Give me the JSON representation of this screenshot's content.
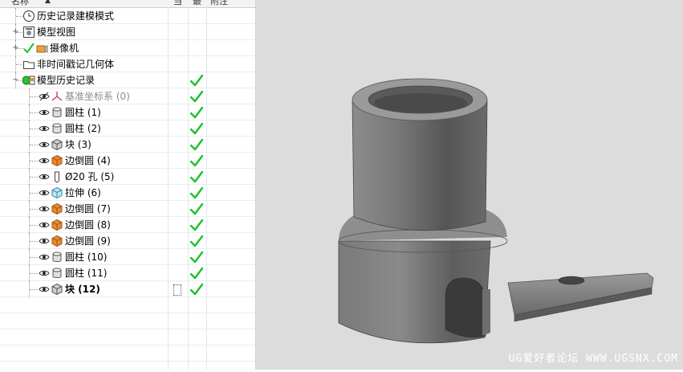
{
  "header": {
    "name_col": "名称",
    "col2": "当",
    "col3": "最",
    "col4": "附注"
  },
  "tree": [
    {
      "label": "历史记录建模模式",
      "icon": "clock-icon",
      "checked": false,
      "expander": ""
    },
    {
      "label": "模型视图",
      "icon": "model-view-icon",
      "checked": false,
      "expander": "+"
    },
    {
      "label": "摄像机",
      "icon": "camera-icon",
      "checked": false,
      "expander": "+"
    },
    {
      "label": "非时间戳记几何体",
      "icon": "folder-icon",
      "checked": false,
      "expander": ""
    },
    {
      "label": "模型历史记录",
      "icon": "history-icon",
      "checked": true,
      "expander": "−"
    },
    {
      "label": "基准坐标系 (0)",
      "icon": "datum-csys-icon",
      "checked": true,
      "expander": ""
    },
    {
      "label": "圆柱 (1)",
      "icon": "cylinder-icon",
      "checked": true,
      "expander": ""
    },
    {
      "label": "圆柱 (2)",
      "icon": "cylinder-icon",
      "checked": true,
      "expander": ""
    },
    {
      "label": "块 (3)",
      "icon": "block-icon",
      "checked": true,
      "expander": ""
    },
    {
      "label": "边倒圆 (4)",
      "icon": "edge-blend-icon",
      "checked": true,
      "expander": ""
    },
    {
      "label": "Ø20 孔 (5)",
      "icon": "hole-icon",
      "checked": true,
      "expander": ""
    },
    {
      "label": "拉伸 (6)",
      "icon": "extrude-icon",
      "checked": true,
      "expander": ""
    },
    {
      "label": "边倒圆 (7)",
      "icon": "edge-blend-icon",
      "checked": true,
      "expander": ""
    },
    {
      "label": "边倒圆 (8)",
      "icon": "edge-blend-icon",
      "checked": true,
      "expander": ""
    },
    {
      "label": "边倒圆 (9)",
      "icon": "edge-blend-icon",
      "checked": true,
      "expander": ""
    },
    {
      "label": "圆柱 (10)",
      "icon": "cylinder-icon",
      "checked": true,
      "expander": ""
    },
    {
      "label": "圆柱 (11)",
      "icon": "cylinder-icon",
      "checked": true,
      "expander": ""
    },
    {
      "label": "块 (12)",
      "icon": "block-icon",
      "checked": true,
      "expander": ""
    }
  ],
  "colors": {
    "check": "#1fbf2a",
    "blend": "#e88a2a",
    "model_gray": "#7a7a7a",
    "viewport_bg": "#dcdcdc"
  },
  "watermark": "UG爱好者论坛 WWW.UGSNX.COM"
}
